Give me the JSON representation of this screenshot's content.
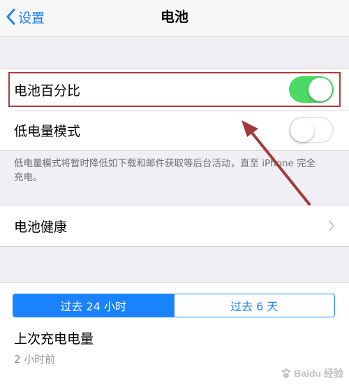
{
  "nav": {
    "back_label": "设置",
    "title": "电池"
  },
  "battery_group": {
    "battery_percentage_label": "电池百分比",
    "battery_percentage_on": true,
    "low_power_label": "低电量模式",
    "low_power_on": false
  },
  "footnote": "低电量模式将暂时降低如下载和邮件获取等后台活动，直至 iPhone 完全充电。",
  "health": {
    "label": "电池健康"
  },
  "usage": {
    "segments": [
      "过去 24 小时",
      "过去 6 天"
    ],
    "selected_segment": 0,
    "last_charge_label": "上次充电电量",
    "last_charge_value": "2 小时前"
  },
  "watermark": "Baidu 经验",
  "colors": {
    "accent": "#1a82fb",
    "toggle_on": "#4cd964",
    "highlight": "#b23a3a",
    "annotation_arrow": "#a33a3a"
  }
}
